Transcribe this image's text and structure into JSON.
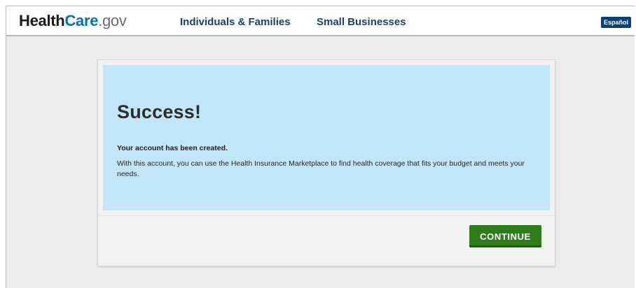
{
  "header": {
    "logo": {
      "part1": "Health",
      "part2": "Care",
      "part3": ".gov"
    },
    "nav": {
      "individuals_families": "Individuals & Families",
      "small_businesses": "Small Businesses"
    },
    "language_button": "Español"
  },
  "main": {
    "notice": {
      "title": "Success!",
      "lead": "Your account has been created.",
      "body": "With this account, you can use the Health Insurance Marketplace to find health coverage that fits your budget and meets your needs."
    },
    "continue_label": "CONTINUE"
  },
  "colors": {
    "brand_blue": "#0071bc",
    "nav_text": "#233f66",
    "notice_background": "#c2e5f7",
    "continue_green": "#2e7d1a",
    "language_badge": "#0a3f7a"
  }
}
